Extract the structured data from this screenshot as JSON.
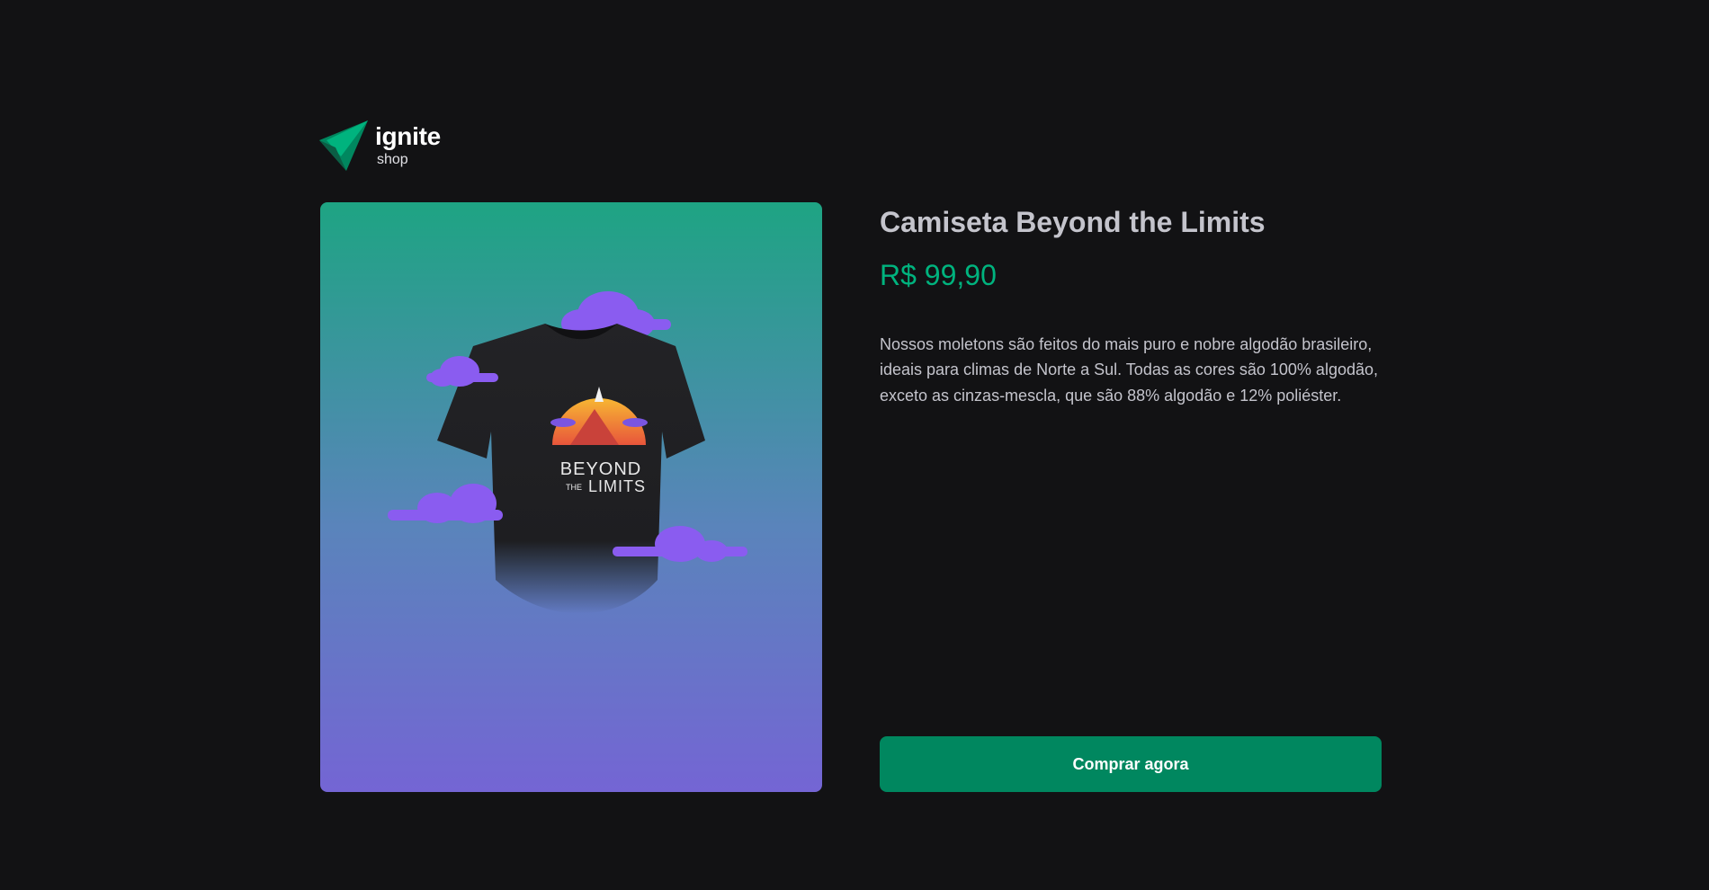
{
  "header": {
    "logo_title": "ignite",
    "logo_subtitle": "shop",
    "logo_icon": "ignite-arrow-logo-icon"
  },
  "product": {
    "image_alt": "T-shirt product image",
    "tshirt_print": {
      "line1": "BEYOND",
      "line2_small": "THE",
      "line2": "LIMITS"
    },
    "title": "Camiseta Beyond the Limits",
    "price": "R$ 99,90",
    "description": "Nossos moletons são feitos do mais puro e nobre algodão brasileiro, ideais para climas de Norte a Sul. Todas as cores são 100% algodão, exceto as cinzas-mescla, que são 88% algodão e 12% poliéster.",
    "buy_label": "Comprar agora"
  },
  "colors": {
    "background": "#121214",
    "accent": "#00b37e",
    "button": "#00875f",
    "title": "#c4c4cc",
    "gradient_top": "#1ea483",
    "gradient_bottom": "#7465d4"
  }
}
